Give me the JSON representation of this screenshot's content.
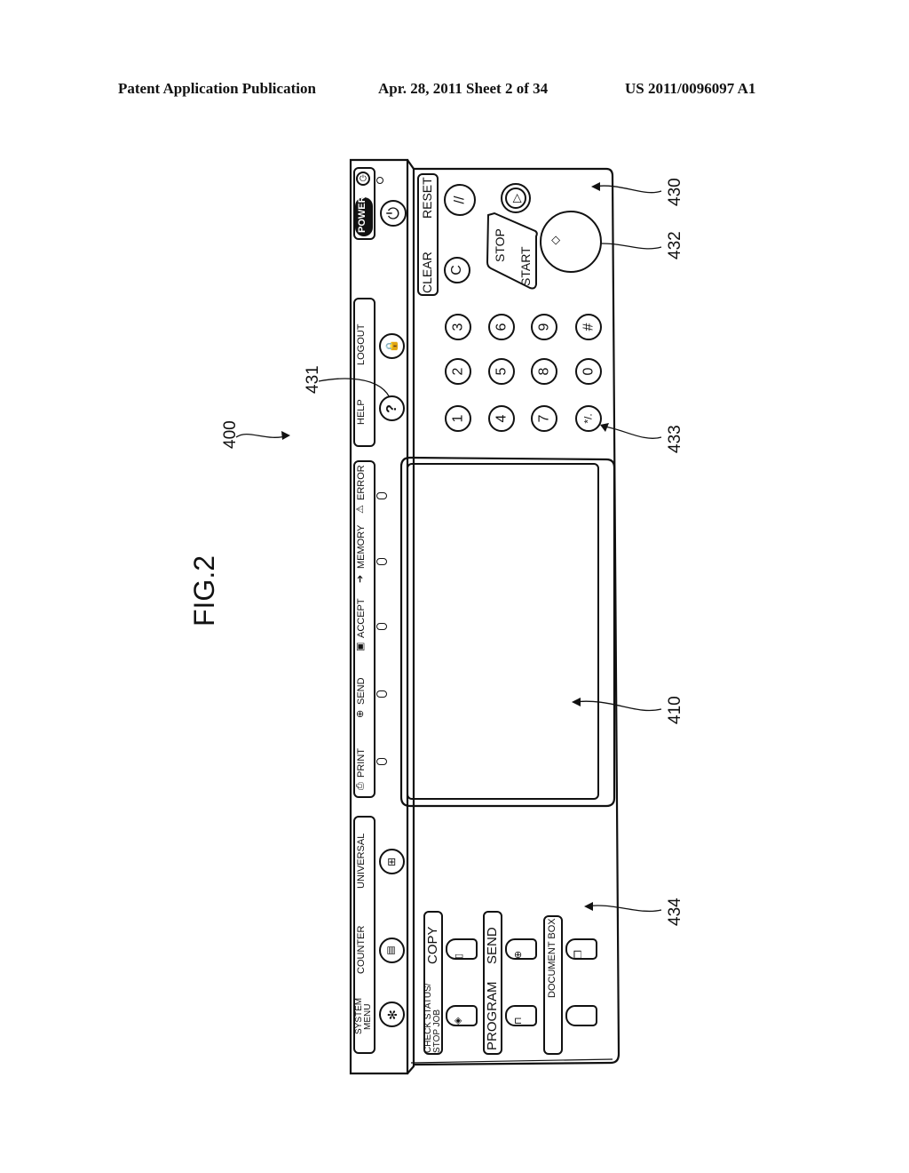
{
  "header": {
    "left": "Patent Application Publication",
    "middle": "Apr. 28, 2011  Sheet 2 of 34",
    "right": "US 2011/0096097 A1"
  },
  "figure": {
    "title": "FIG.2",
    "refs": {
      "panel": "400",
      "screen": "410",
      "right_section": "430",
      "help_key": "431",
      "start_key": "432",
      "keypad": "433",
      "function_keys": "434"
    }
  },
  "left_strip": {
    "power_label": "POWER",
    "help_label": "HELP",
    "logout_label": "LOGOUT",
    "status_labels": [
      "PRINT",
      "SEND",
      "ACCEPT",
      "MEMORY",
      "ERROR"
    ],
    "system_menu_label": "SYSTEM MENU",
    "system_label_1": "SYSTEM",
    "system_label_2": "MENU",
    "counter_label": "COUNTER",
    "universal_label": "UNIVERSAL"
  },
  "control_area": {
    "clear_label": "CLEAR",
    "reset_label": "RESET",
    "clear_key": "C",
    "reset_key": "//",
    "stop_label": "STOP",
    "start_label": "START",
    "keypad": [
      [
        "1",
        "2",
        "3"
      ],
      [
        "4",
        "5",
        "6"
      ],
      [
        "7",
        "8",
        "9"
      ],
      [
        "*/.",
        "0",
        "#"
      ]
    ]
  },
  "function_area": {
    "group1_line1": "CHECK STATUS/",
    "group1_line2": "STOP JOB",
    "copy_label": "COPY",
    "program_label": "PROGRAM",
    "send_label": "SEND",
    "document_box_label": "DOCUMENT BOX"
  }
}
